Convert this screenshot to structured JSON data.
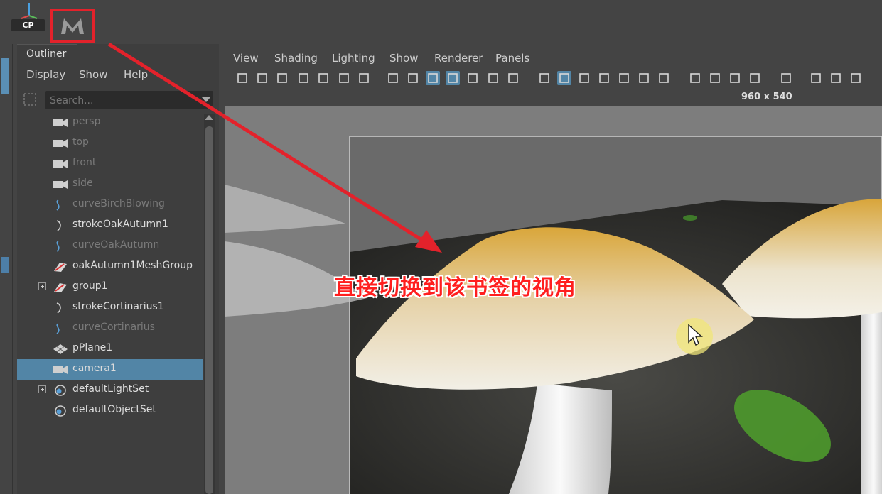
{
  "top": {
    "cp_label": "CP"
  },
  "outliner": {
    "tab_label": "Outliner",
    "menu": [
      "Display",
      "Show",
      "Help"
    ],
    "search_placeholder": "Search...",
    "items": [
      {
        "label": "persp",
        "icon": "camera-icon",
        "dim": true
      },
      {
        "label": "top",
        "icon": "camera-icon",
        "dim": true
      },
      {
        "label": "front",
        "icon": "camera-icon",
        "dim": true
      },
      {
        "label": "side",
        "icon": "camera-icon",
        "dim": true
      },
      {
        "label": "curveBirchBlowing",
        "icon": "curve-icon",
        "dim": true
      },
      {
        "label": "strokeOakAutumn1",
        "icon": "stroke-icon",
        "dim": false
      },
      {
        "label": "curveOakAutumn",
        "icon": "curve-icon",
        "dim": true
      },
      {
        "label": "oakAutumn1MeshGroup",
        "icon": "paint-effects-icon",
        "dim": false
      },
      {
        "label": "group1",
        "icon": "paint-effects-icon",
        "dim": false,
        "expandable": true
      },
      {
        "label": "strokeCortinarius1",
        "icon": "stroke-icon",
        "dim": false
      },
      {
        "label": "curveCortinarius",
        "icon": "curve-icon",
        "dim": true
      },
      {
        "label": "pPlane1",
        "icon": "mesh-icon",
        "dim": false
      },
      {
        "label": "camera1",
        "icon": "camera-icon",
        "dim": false,
        "selected": true
      },
      {
        "label": "defaultLightSet",
        "icon": "set-icon",
        "dim": false,
        "expandable": true
      },
      {
        "label": "defaultObjectSet",
        "icon": "set-icon",
        "dim": false
      }
    ]
  },
  "viewport": {
    "menu": [
      "View",
      "Shading",
      "Lighting",
      "Show",
      "Renderer",
      "Panels"
    ],
    "resolution": "960 x 540"
  },
  "annotation": {
    "caption": "直接切换到该书签的视角",
    "accent_color": "#e3222b"
  }
}
